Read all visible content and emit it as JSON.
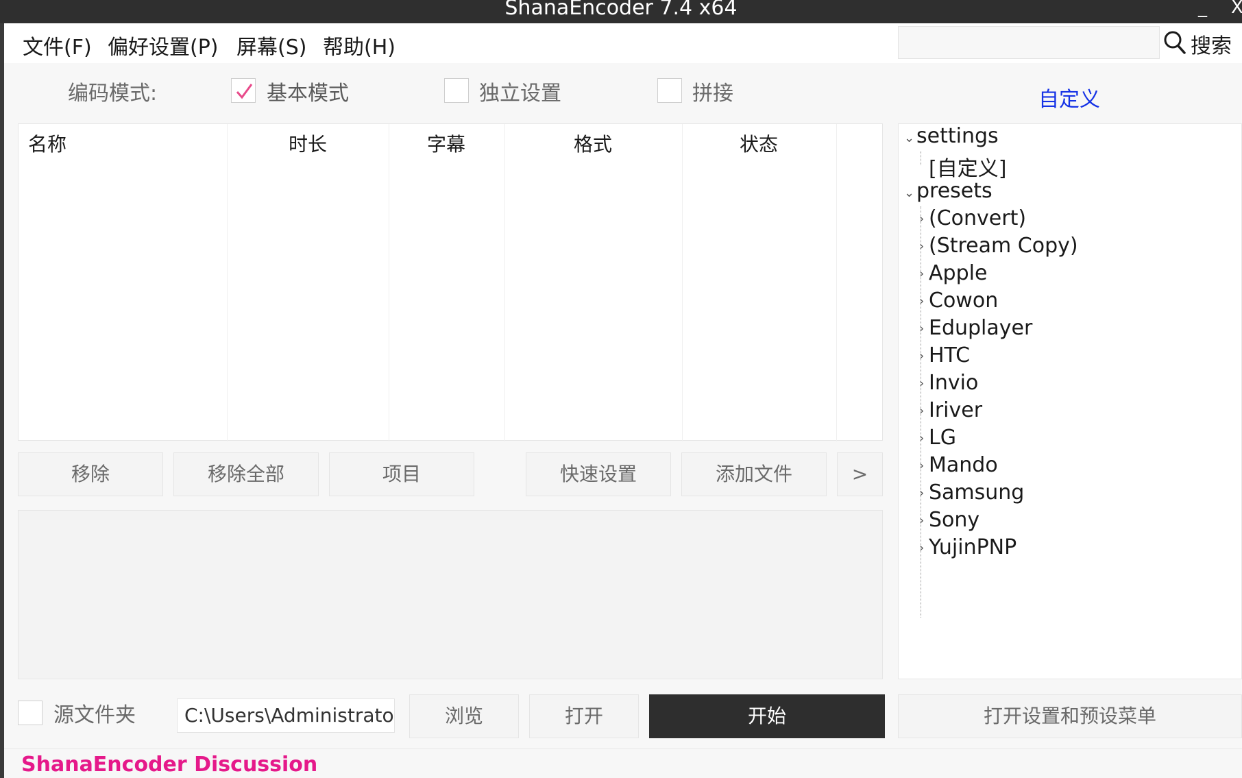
{
  "window": {
    "title": "ShanaEncoder 7.4 x64",
    "minimize": "_",
    "close": "X"
  },
  "menu": {
    "items": [
      "文件(F)",
      "偏好设置(P)",
      "屏幕(S)",
      "帮助(H)"
    ]
  },
  "search": {
    "value": "",
    "label": "搜索"
  },
  "mode": {
    "label": "编码模式:",
    "options": [
      {
        "label": "基本模式",
        "checked": true
      },
      {
        "label": "独立设置",
        "checked": false
      },
      {
        "label": "拼接",
        "checked": false
      }
    ],
    "custom_link": "自定义"
  },
  "file_table": {
    "columns": [
      "名称",
      "时长",
      "字幕",
      "格式",
      "状态"
    ],
    "rows": []
  },
  "actions": {
    "remove": "移除",
    "remove_all": "移除全部",
    "project": "项目",
    "quick_settings": "快速设置",
    "add_file": "添加文件",
    "more": ">"
  },
  "tree": {
    "settings": {
      "label": "settings",
      "children": [
        "[自定义]"
      ]
    },
    "presets": {
      "label": "presets",
      "children": [
        "(Convert)",
        "(Stream Copy)",
        "Apple",
        "Cowon",
        "Eduplayer",
        "HTC",
        "Invio",
        "Iriver",
        "LG",
        "Mando",
        "Samsung",
        "Sony",
        "YujinPNP"
      ]
    }
  },
  "output": {
    "source_folder_label": "源文件夹",
    "source_folder_checked": false,
    "path": "C:\\Users\\Administrato",
    "browse": "浏览",
    "open": "打开",
    "start": "开始",
    "open_settings_menu": "打开设置和预设菜单"
  },
  "footer": {
    "link": "ShanaEncoder Discussion"
  },
  "colors": {
    "accent_pink": "#e5198a",
    "link_blue": "#1633e6",
    "dark_button": "#2e2e2e",
    "check_mark": "#e84a8a"
  }
}
